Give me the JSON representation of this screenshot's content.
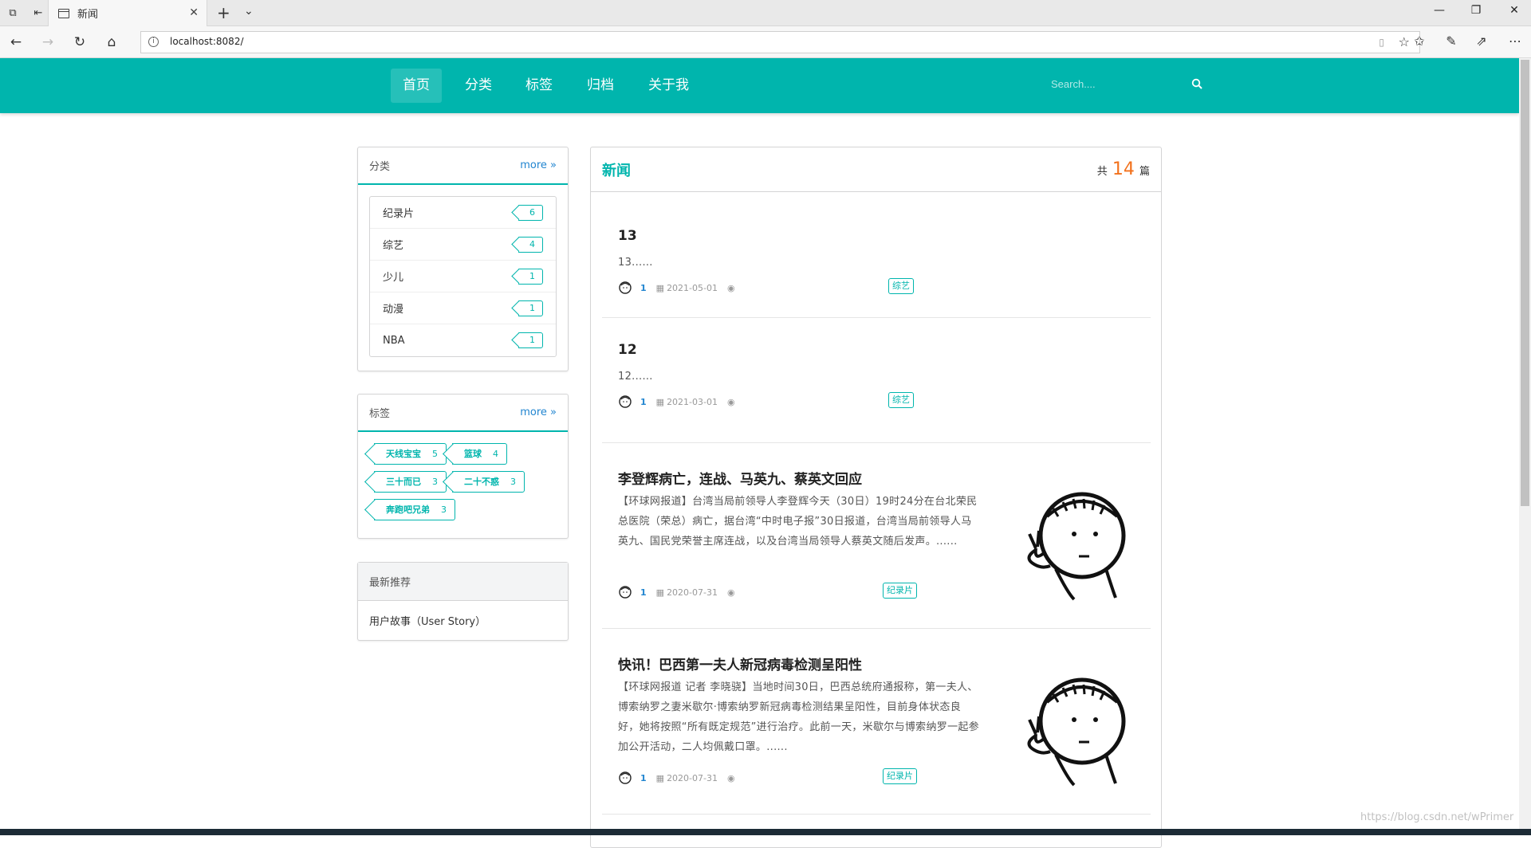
{
  "browser": {
    "tab_title": "新闻",
    "url": "localhost:8082/"
  },
  "nav": {
    "items": [
      "首页",
      "分类",
      "标签",
      "归档",
      "关于我"
    ],
    "active": "首页",
    "search_placeholder": "Search...."
  },
  "categories": {
    "title": "分类",
    "more": "more",
    "items": [
      {
        "name": "纪录片",
        "count": "6"
      },
      {
        "name": "综艺",
        "count": "4"
      },
      {
        "name": "少儿",
        "count": "1"
      },
      {
        "name": "动漫",
        "count": "1"
      },
      {
        "name": "NBA",
        "count": "1"
      }
    ]
  },
  "tags": {
    "title": "标签",
    "more": "more",
    "items": [
      {
        "name": "天线宝宝",
        "count": "5"
      },
      {
        "name": "篮球",
        "count": "4"
      },
      {
        "name": "三十而已",
        "count": "3"
      },
      {
        "name": "二十不惑",
        "count": "3"
      },
      {
        "name": "奔跑吧兄弟",
        "count": "3"
      }
    ]
  },
  "recommend": {
    "title": "最新推荐",
    "items": [
      "用户故事（User Story）"
    ]
  },
  "main": {
    "title": "新闻",
    "count_prefix": "共",
    "count": "14",
    "count_suffix": "篇"
  },
  "posts": [
    {
      "title": "13",
      "desc": "13......",
      "user": "1",
      "date": "2021-05-01",
      "tag": "综艺",
      "has_image": false
    },
    {
      "title": "12",
      "desc": "12......",
      "user": "1",
      "date": "2021-03-01",
      "tag": "综艺",
      "has_image": false
    },
    {
      "title": "李登辉病亡，连战、马英九、蔡英文回应",
      "desc": "【环球网报道】台湾当局前领导人李登辉今天（30日）19时24分在台北荣民总医院（荣总）病亡，据台湾“中时电子报”30日报道，台湾当局前领导人马英九、国民党荣誉主席连战，以及台湾当局领导人蔡英文随后发声。......",
      "user": "1",
      "date": "2020-07-31",
      "tag": "纪录片",
      "has_image": true
    },
    {
      "title": "快讯！巴西第一夫人新冠病毒检测呈阳性",
      "desc": "【环球网报道 记者 李晓骁】当地时间30日，巴西总统府通报称，第一夫人、博索纳罗之妻米歇尔·博索纳罗新冠病毒检测结果呈阳性，目前身体状态良好，她将按照“所有既定规范”进行治疗。此前一天，米歇尔与博索纳罗一起参加公开活动，二人均佩戴口罩。......",
      "user": "1",
      "date": "2020-07-31",
      "tag": "纪录片",
      "has_image": true
    }
  ],
  "watermark": "https://blog.csdn.net/wPrimer"
}
